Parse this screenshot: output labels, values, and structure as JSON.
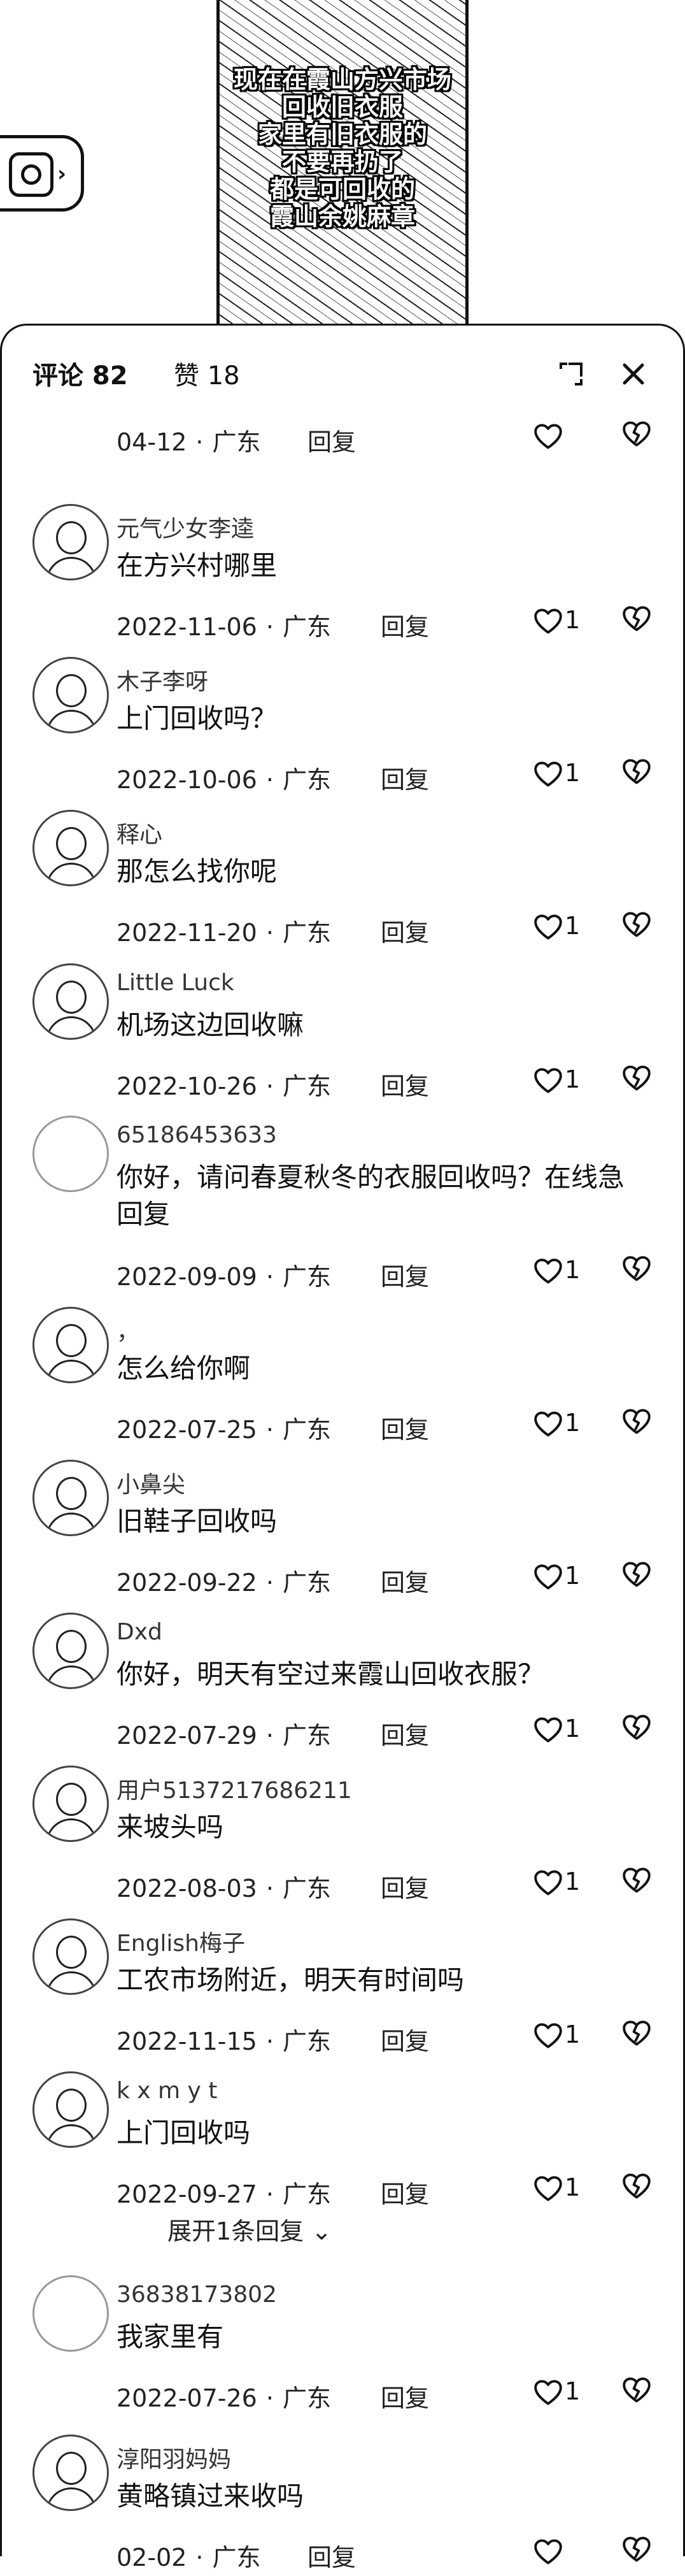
{
  "video": {
    "caption_lines": [
      "现在在霞山方兴市场",
      "回收旧衣服",
      "家里有旧衣服的",
      "不要再扔了",
      "都是可回收的",
      "霞山余姚麻章"
    ]
  },
  "sheet": {
    "tab_comments": "评论 82",
    "tab_likes": "赞 18"
  },
  "comments": [
    {
      "user": "",
      "text": "",
      "date": "04-12",
      "region": "广东",
      "reply": "回复",
      "likes": "",
      "avatar": "none"
    },
    {
      "user": "元气少女李逵",
      "text": "在方兴村哪里",
      "date": "2022-11-06",
      "region": "广东",
      "reply": "回复",
      "likes": "1",
      "avatar": "drawn"
    },
    {
      "user": "木子李呀",
      "text": "上门回收吗？",
      "date": "2022-10-06",
      "region": "广东",
      "reply": "回复",
      "likes": "1",
      "avatar": "drawn"
    },
    {
      "user": "释心",
      "text": "那怎么找你呢",
      "date": "2022-11-20",
      "region": "广东",
      "reply": "回复",
      "likes": "1",
      "avatar": "drawn"
    },
    {
      "user": "Little Luck",
      "text": "机场这边回收嘛",
      "date": "2022-10-26",
      "region": "广东",
      "reply": "回复",
      "likes": "1",
      "avatar": "drawn"
    },
    {
      "user": "65186453633",
      "text": "你好，请问春夏秋冬的衣服回收吗？在线急回复",
      "date": "2022-09-09",
      "region": "广东",
      "reply": "回复",
      "likes": "1",
      "avatar": "blank"
    },
    {
      "user": "，",
      "text": "怎么给你啊",
      "date": "2022-07-25",
      "region": "广东",
      "reply": "回复",
      "likes": "1",
      "avatar": "drawn"
    },
    {
      "user": "小鼻尖",
      "text": "旧鞋子回收吗",
      "date": "2022-09-22",
      "region": "广东",
      "reply": "回复",
      "likes": "1",
      "avatar": "drawn"
    },
    {
      "user": "Dxd",
      "text": "你好，明天有空过来霞山回收衣服？",
      "date": "2022-07-29",
      "region": "广东",
      "reply": "回复",
      "likes": "1",
      "avatar": "drawn"
    },
    {
      "user": "用户5137217686211",
      "text": "来坡头吗",
      "date": "2022-08-03",
      "region": "广东",
      "reply": "回复",
      "likes": "1",
      "avatar": "drawn"
    },
    {
      "user": "English梅子",
      "text": "工农市场附近，明天有时间吗",
      "date": "2022-11-15",
      "region": "广东",
      "reply": "回复",
      "likes": "1",
      "avatar": "drawn"
    },
    {
      "user": "k x m y t",
      "text": "上门回收吗",
      "date": "2022-09-27",
      "region": "广东",
      "reply": "回复",
      "likes": "1",
      "avatar": "drawn"
    },
    {
      "user": "36838173802",
      "text": "我家里有",
      "date": "2022-07-26",
      "region": "广东",
      "reply": "回复",
      "likes": "1",
      "avatar": "blank"
    },
    {
      "user": "淳阳羽妈妈",
      "text": "黄略镇过来收吗",
      "date": "02-02",
      "region": "广东",
      "reply": "回复",
      "likes": "",
      "avatar": "drawn"
    }
  ],
  "expand_replies": "展开1条回复"
}
